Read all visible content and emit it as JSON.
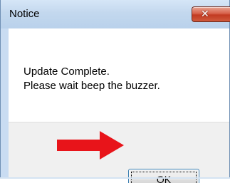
{
  "dialog": {
    "title": "Notice",
    "close_icon": "close-icon",
    "close_glyph": "✕",
    "message_lines": [
      "Update Complete.",
      "Please wait beep the buzzer."
    ],
    "ok_label": "OK"
  },
  "annotation": {
    "arrow_icon": "arrow-right-icon",
    "arrow_color": "#e8141a"
  },
  "colors": {
    "title_bar": "#c3d8ee",
    "close_button": "#c7452c",
    "focus_border": "#3c7fb1"
  }
}
